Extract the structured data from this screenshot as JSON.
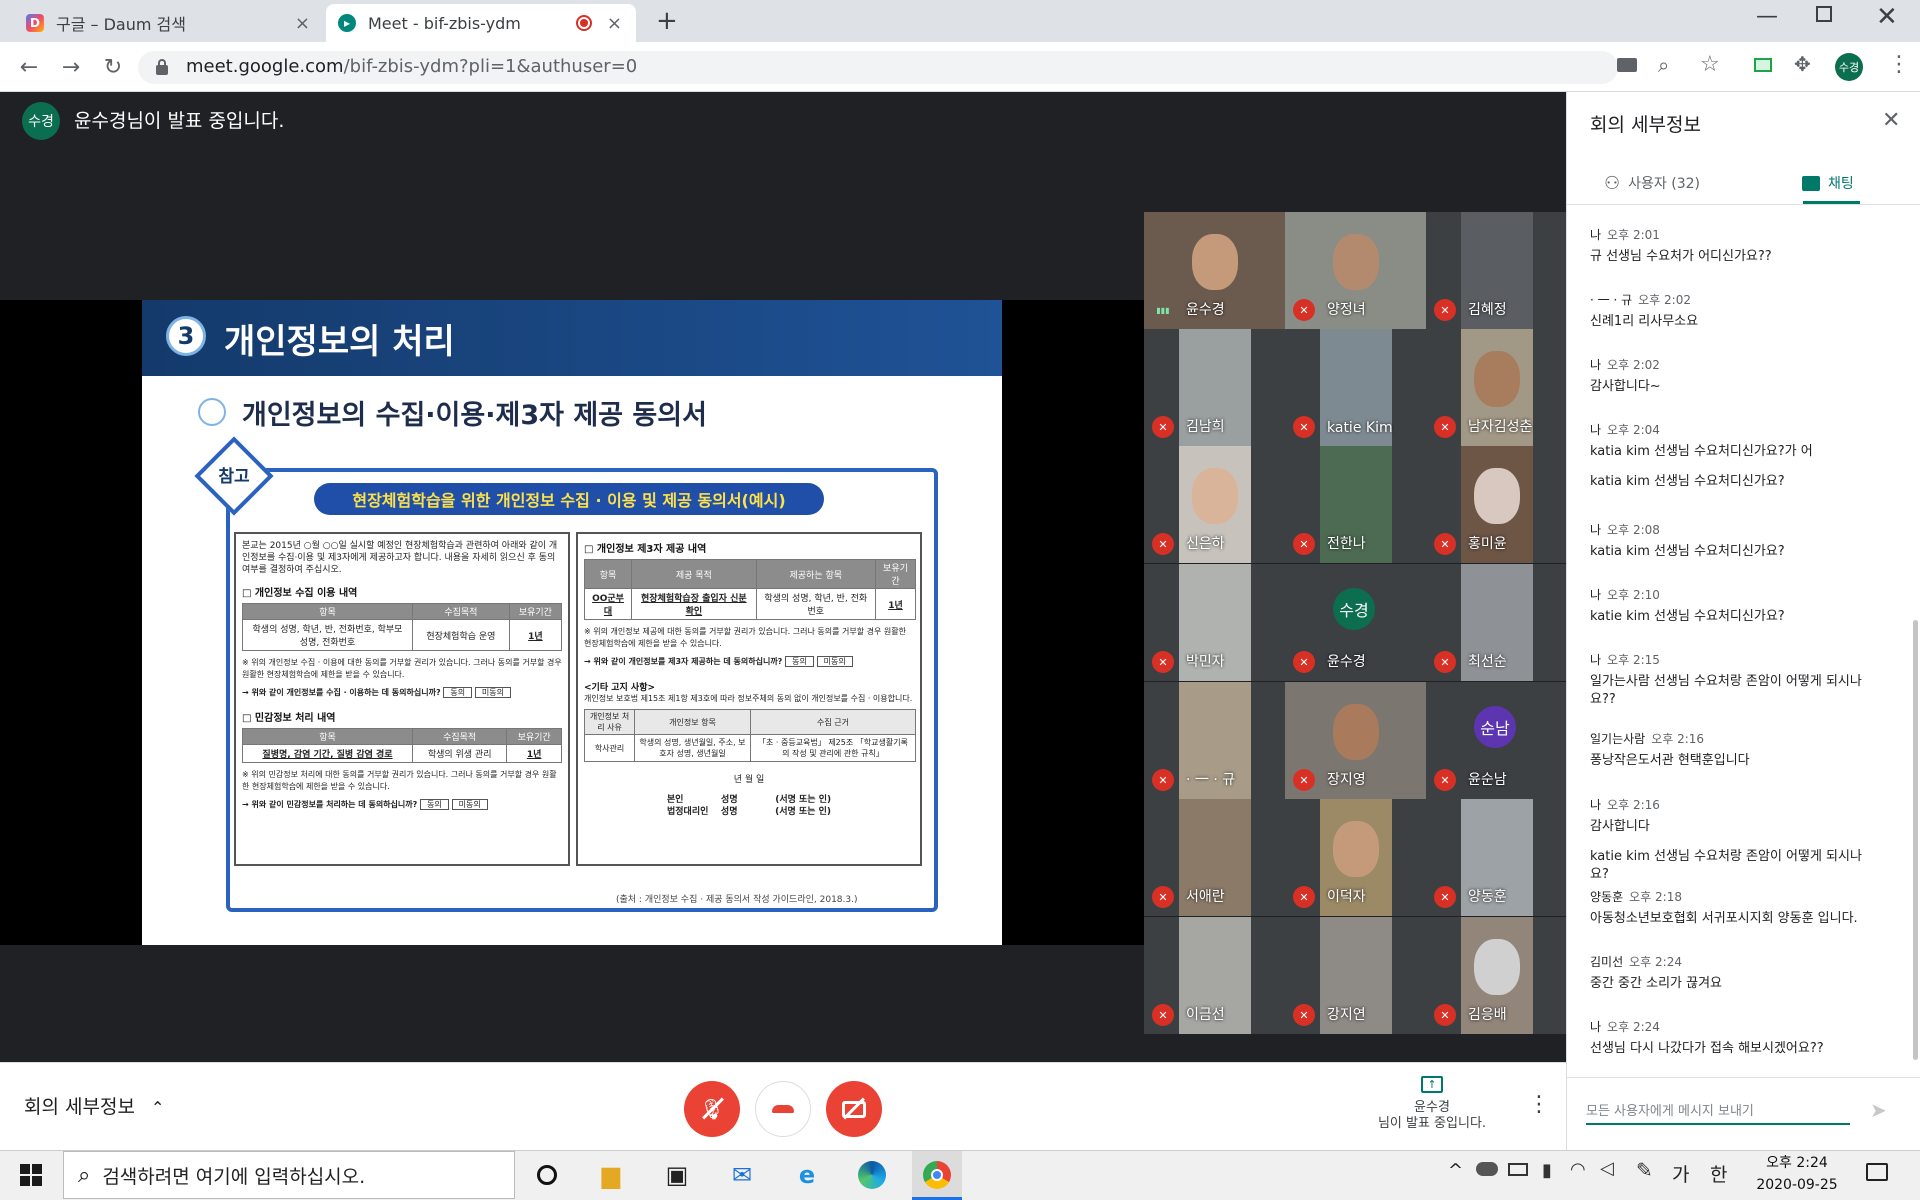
{
  "browser": {
    "tabs": [
      {
        "label": "구글 – Daum 검색",
        "close": "×"
      },
      {
        "label": "Meet - bif-zbis-ydm",
        "close": "×"
      }
    ],
    "new_tab": "+",
    "url_host": "meet.google.com",
    "url_path": "/bif-zbis-ydm?pli=1&authuser=0",
    "profile_initials": "수경"
  },
  "meet": {
    "presenter_initials": "수경",
    "presenting_message": "윤수경님이 발표 중입니다.",
    "slide": {
      "number": "3",
      "title": "개인정보의 처리",
      "subtitle": "개인정보의 수집·이용·제3자 제공 동의서",
      "tag": "참고",
      "banner": "현장체험학습을 위한 개인정보 수집 · 이용 및 제공 동의서(예시)",
      "intro": "본교는 2015년 ○월 ○○일 실시할 예정인 현장체험학습과 관련하여 아래와 같이 개인정보를 수집·이용 및 제3자에게 제공하고자 합니다. 내용을 자세히 읽으신 후 동의 여부를 결정하여 주십시오.",
      "left": {
        "sec1_title": "□ 개인정보 수집 이용 내역",
        "t1_headers": [
          "항목",
          "수집목적",
          "보유기간"
        ],
        "t1_row": [
          "학생의 성명, 학년, 반, 전화번호, 학부모 성명, 전화번호",
          "현장체험학습 운영",
          "1년"
        ],
        "note1": "※ 위의 개인정보 수집 · 이용에 대한 동의를 거부할 권리가 있습니다. 그러나 동의를 거부할 경우 원활한 현장체험학습에 제한을 받을 수 있습니다.",
        "q1": "→ 위와 같이 개인정보를 수집 · 이용하는 데 동의하십니까?",
        "sec2_title": "□ 민감정보 처리 내역",
        "t2_headers": [
          "항목",
          "수집목적",
          "보유기간"
        ],
        "t2_row": [
          "질병명, 감염 기간, 질병 감염 경로",
          "학생의 위생 관리",
          "1년"
        ],
        "note2": "※ 위의 민감정보 처리에 대한 동의를 거부할 권리가 있습니다. 그러나 동의를 거부할 경우 원활한 현장체험학습에 제한을 받을 수 있습니다.",
        "q2": "→ 위와 같이 민감정보를 처리하는 데 동의하십니까?",
        "agree": "동의",
        "disagree": "미동의"
      },
      "right": {
        "sec_title": "□ 개인정보 제3자 제공 내역",
        "t_headers": [
          "항목",
          "제공 목적",
          "제공하는 항목",
          "보유기간"
        ],
        "t_row": [
          "OO군부대",
          "현장체험학습장 출입자 신분 확인",
          "학생의 성명, 학년, 반, 전화번호",
          "1년"
        ],
        "note": "※ 위의 개인정보 제공에 대한 동의를 거부할 권리가 있습니다. 그러나 동의를 거부할 경우 원활한 현장체험학습에 제한을 받을 수 있습니다.",
        "q": "→ 위와 같이 개인정보를 제3자 제공하는 데 동의하십니까?",
        "other_title": "<기타 고지 사항>",
        "other_text": "개인정보 보호법 제15조 제1항 제3호에 따라 정보주체의 동의 없이 개인정보를 수집 · 이용합니다.",
        "t3_headers": [
          "개인정보 처리 사유",
          "개인정보 항목",
          "수집 근거"
        ],
        "t3_row": [
          "학사관리",
          "학생의 성명, 생년월일, 주소, 보호자 성명, 생년월일",
          "「초 · 중등교육법」 제25조 「학교생활기록의 작성 및 관리에 관한 규칙」"
        ],
        "date_line": "년      월      일",
        "sign1": "본인            성명            (서명 또는 인)",
        "sign2": "법정대리인    성명            (서명 또는 인)"
      },
      "source": "(출처 : 개인정보 수집 · 제공 동의서 작성 가이드라인, 2018.3.)"
    },
    "participants": [
      {
        "name": "윤수경",
        "muted": false,
        "bg": "#6b5a4e",
        "skin": "#c59a7a"
      },
      {
        "name": "양정녀",
        "muted": true,
        "bg": "#8a8d86",
        "skin": "#b48a6e"
      },
      {
        "name": "김혜정",
        "muted": true,
        "bg": "#5a5d62",
        "skin": ""
      },
      {
        "name": "김남희",
        "muted": true,
        "bg": "#9aa0a0",
        "skin": ""
      },
      {
        "name": "katie Kim",
        "muted": true,
        "bg": "#7e8a92",
        "skin": ""
      },
      {
        "name": "남자김성춘",
        "muted": true,
        "bg": "#a29886",
        "skin": "#a77d5e"
      },
      {
        "name": "신은하",
        "muted": true,
        "bg": "#c7c2bc",
        "skin": "#d9b39a"
      },
      {
        "name": "전한나",
        "muted": true,
        "bg": "#4d6b52",
        "skin": ""
      },
      {
        "name": "홍미윤",
        "muted": true,
        "bg": "#6e5646",
        "skin": "#d8c8c0"
      },
      {
        "name": "박민자",
        "muted": true,
        "bg": "#b0b2b0",
        "skin": ""
      },
      {
        "name": "윤수경",
        "muted": true,
        "bg": "",
        "avatar": "수경",
        "avatar_color": "#0b6e4f"
      },
      {
        "name": "최선순",
        "muted": true,
        "bg": "#8e9296",
        "skin": ""
      },
      {
        "name": "· 一 · 규",
        "muted": true,
        "bg": "#a89c88",
        "skin": ""
      },
      {
        "name": "장지영",
        "muted": true,
        "bg": "#7c7670",
        "skin": "#a97a5c"
      },
      {
        "name": "윤순남",
        "muted": true,
        "bg": "",
        "avatar": "순남",
        "avatar_color": "#5e35b1"
      },
      {
        "name": "서애란",
        "muted": true,
        "bg": "#8c7a68",
        "skin": ""
      },
      {
        "name": "이덕자",
        "muted": true,
        "bg": "#9c8a66",
        "skin": "#c49a7a"
      },
      {
        "name": "양동훈",
        "muted": true,
        "bg": "#9da2a6",
        "skin": ""
      },
      {
        "name": "이금선",
        "muted": true,
        "bg": "#a6a6a2",
        "skin": ""
      },
      {
        "name": "강지연",
        "muted": true,
        "bg": "#8e8a86",
        "skin": ""
      },
      {
        "name": "김응배",
        "muted": true,
        "bg": "#92857a",
        "skin": "#d0d0d0"
      }
    ],
    "controls": {
      "details_label": "회의 세부정보",
      "present_name": "윤수경",
      "present_msg": "님이 발표 중입니다."
    }
  },
  "side_panel": {
    "title": "회의 세부정보",
    "tab_people": "사용자 (32)",
    "tab_chat": "채팅",
    "messages": [
      {
        "who": "나",
        "time": "오후 2:01",
        "lines": [
          "규 선생님 수요처가 어디신가요??"
        ]
      },
      {
        "who": "· 一 · 규",
        "time": "오후 2:02",
        "lines": [
          "신례1리 리사무소요"
        ]
      },
      {
        "who": "나",
        "time": "오후 2:02",
        "lines": [
          "감사합니다~"
        ]
      },
      {
        "who": "나",
        "time": "오후 2:04",
        "lines": [
          "katia kim 선생님 수요처디신가요?가 어",
          "katia kim 선생님 수요처디신가요?"
        ]
      },
      {
        "who": "나",
        "time": "오후 2:08",
        "lines": [
          "katia kim 선생님 수요처디신가요?"
        ]
      },
      {
        "who": "나",
        "time": "오후 2:10",
        "lines": [
          "katie kim 선생님 수요처디신가요?"
        ]
      },
      {
        "who": "나",
        "time": "오후 2:15",
        "lines": [
          "일가는사람 선생님 수요처랑 존암이 어떻게 되시나요??"
        ]
      },
      {
        "who": "일기는사람",
        "time": "오후 2:16",
        "lines": [
          "퐁낭작은도서관 현택훈입니다"
        ]
      },
      {
        "who": "나",
        "time": "오후 2:16",
        "lines": [
          "감사합니다",
          "katie kim 선생님 수요처랑 존암이 어떻게 되시나요?"
        ]
      },
      {
        "who": "양동훈",
        "time": "오후 2:18",
        "lines": [
          "아동청소년보호협회 서귀포시지회 양동훈 입니다."
        ]
      },
      {
        "who": "김미선",
        "time": "오후 2:24",
        "lines": [
          "중간 중간 소리가 끊겨요"
        ]
      },
      {
        "who": "나",
        "time": "오후 2:24",
        "lines": [
          "선생님 다시 나갔다가 접속 해보시겠어요??"
        ]
      }
    ],
    "input_placeholder": "모든 사용자에게 메시지 보내기"
  },
  "taskbar": {
    "search_placeholder": "검색하려면 여기에 입력하십시오.",
    "ime_lang": "가",
    "ime_mode": "한",
    "time": "오후 2:24",
    "date": "2020-09-25"
  },
  "colors": {
    "accent": "#00796b",
    "danger": "#ea4335",
    "slide_blue": "#143a6b"
  }
}
